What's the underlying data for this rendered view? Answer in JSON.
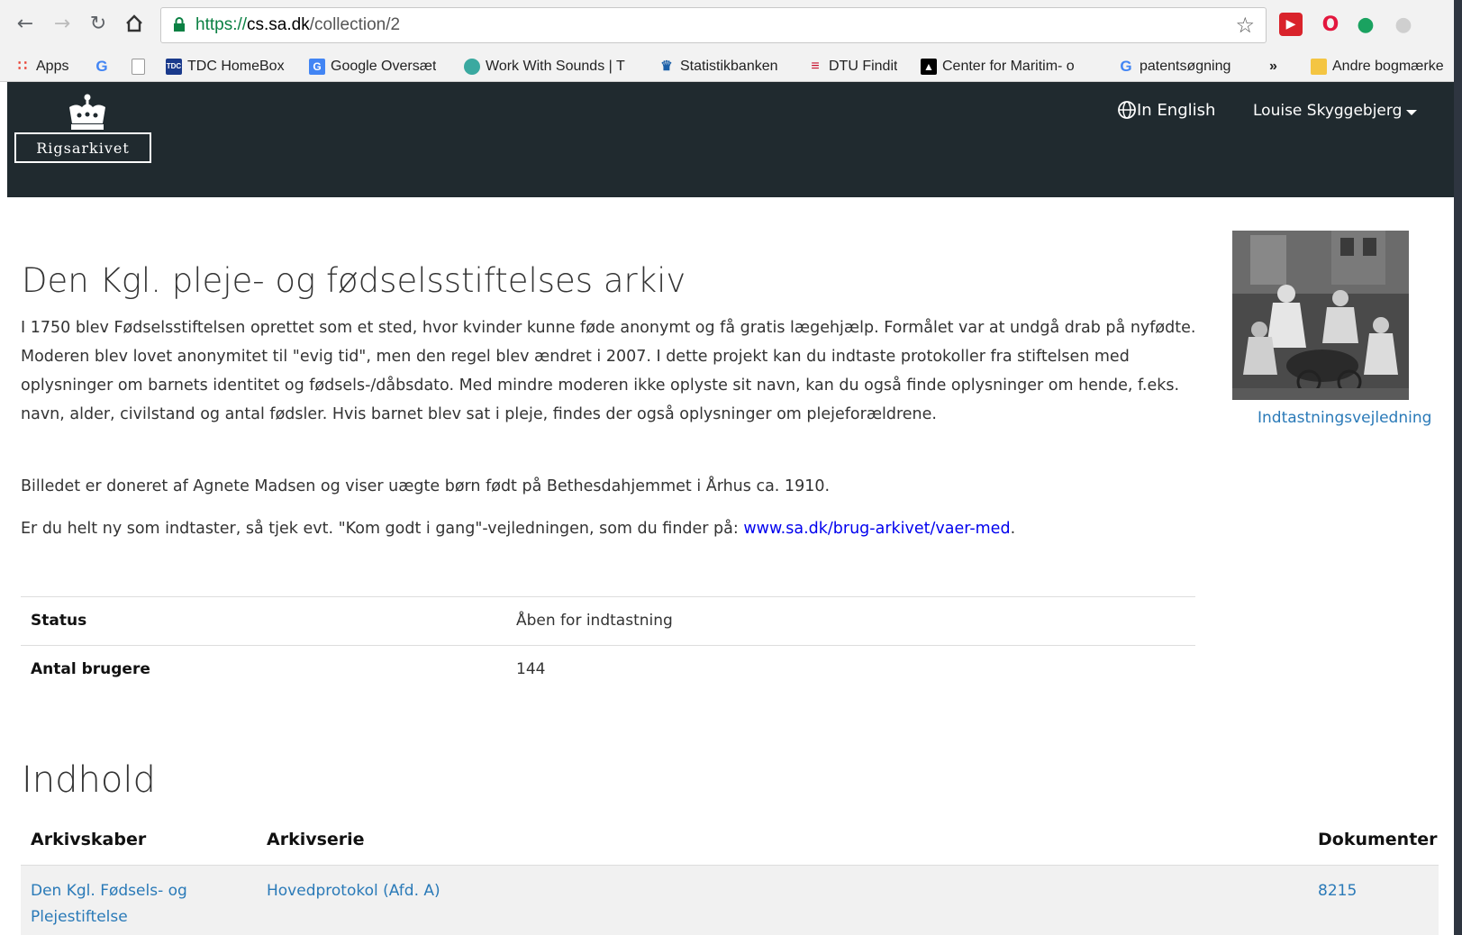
{
  "browser": {
    "url_scheme": "https://",
    "url_host": "cs.sa.dk",
    "url_path": "/collection/2"
  },
  "bookmarks": [
    {
      "label": "Apps",
      "icon": "apps-grid-icon",
      "color": "#e94235"
    },
    {
      "label": "",
      "icon": "google-icon",
      "color": "#4285f4"
    },
    {
      "label": "",
      "icon": "blank-page-icon",
      "color": "#888888"
    },
    {
      "label": "TDC HomeBox",
      "icon": "tdc-icon",
      "color": "#1a3a8c"
    },
    {
      "label": "Google Oversæt",
      "icon": "google-translate-icon",
      "color": "#4285f4"
    },
    {
      "label": "Work With Sounds | T",
      "icon": "work-with-sounds-icon",
      "color": "#3aa9a0"
    },
    {
      "label": "Statistikbanken",
      "icon": "crown-icon",
      "color": "#1a5fa8"
    },
    {
      "label": "DTU Findit",
      "icon": "dtu-icon",
      "color": "#c8102e"
    },
    {
      "label": "Center for Maritim- o",
      "icon": "maritime-icon",
      "color": "#000000"
    },
    {
      "label": "patentsøgning",
      "icon": "google-icon",
      "color": "#4285f4"
    },
    {
      "label": "»",
      "icon": "",
      "color": ""
    },
    {
      "label": "Andre bogmærke",
      "icon": "folder-icon",
      "color": "#f4c542"
    }
  ],
  "header": {
    "logo_text": "Rigsarkivet",
    "language_label": "In English",
    "user_name": "Louise Skyggebjerg"
  },
  "collection": {
    "title": "Den Kgl. pleje- og fødselsstiftelses arkiv",
    "description": "I 1750 blev Fødselsstiftelsen oprettet som et sted, hvor kvinder kunne føde anonymt og få gratis lægehjælp. Formålet var at undgå drab på nyfødte. Moderen blev lovet anonymitet til \"evig tid\", men den regel blev ændret i 2007. I dette projekt kan du indtaste protokoller fra stiftelsen med oplysninger om barnets identitet og fødsels-/dåbsdato. Med mindre moderen ikke oplyste sit navn, kan du også finde oplysninger om hende, f.eks. navn, alder, civilstand og antal fødsler. Hvis barnet blev sat i pleje, findes der også oplysninger om plejeforældrene.",
    "image_note": "Billedet er doneret af Agnete Madsen og viser uægte børn født på Bethesdahjemmet i Århus ca. 1910.",
    "newbie_note": "Er du helt ny som indtaster, så tjek evt. \"Kom godt i gang\"-vejledningen, som du finder på: ",
    "newbie_link": "www.sa.dk/brug-arkivet/vaer-med",
    "newbie_tail": ".",
    "guide_link": "Indtastningsvejledning"
  },
  "info": [
    {
      "key": "Status",
      "value": "Åben for indtastning"
    },
    {
      "key": "Antal brugere",
      "value": "144"
    }
  ],
  "contents": {
    "title": "Indhold",
    "columns": [
      "Arkivskaber",
      "Arkivserie",
      "Dokumenter"
    ],
    "rows": [
      {
        "creator": "Den Kgl. Fødsels- og Plejestiftelse",
        "series": "Hovedprotokol (Afd. A)",
        "documents": "8215"
      }
    ]
  }
}
